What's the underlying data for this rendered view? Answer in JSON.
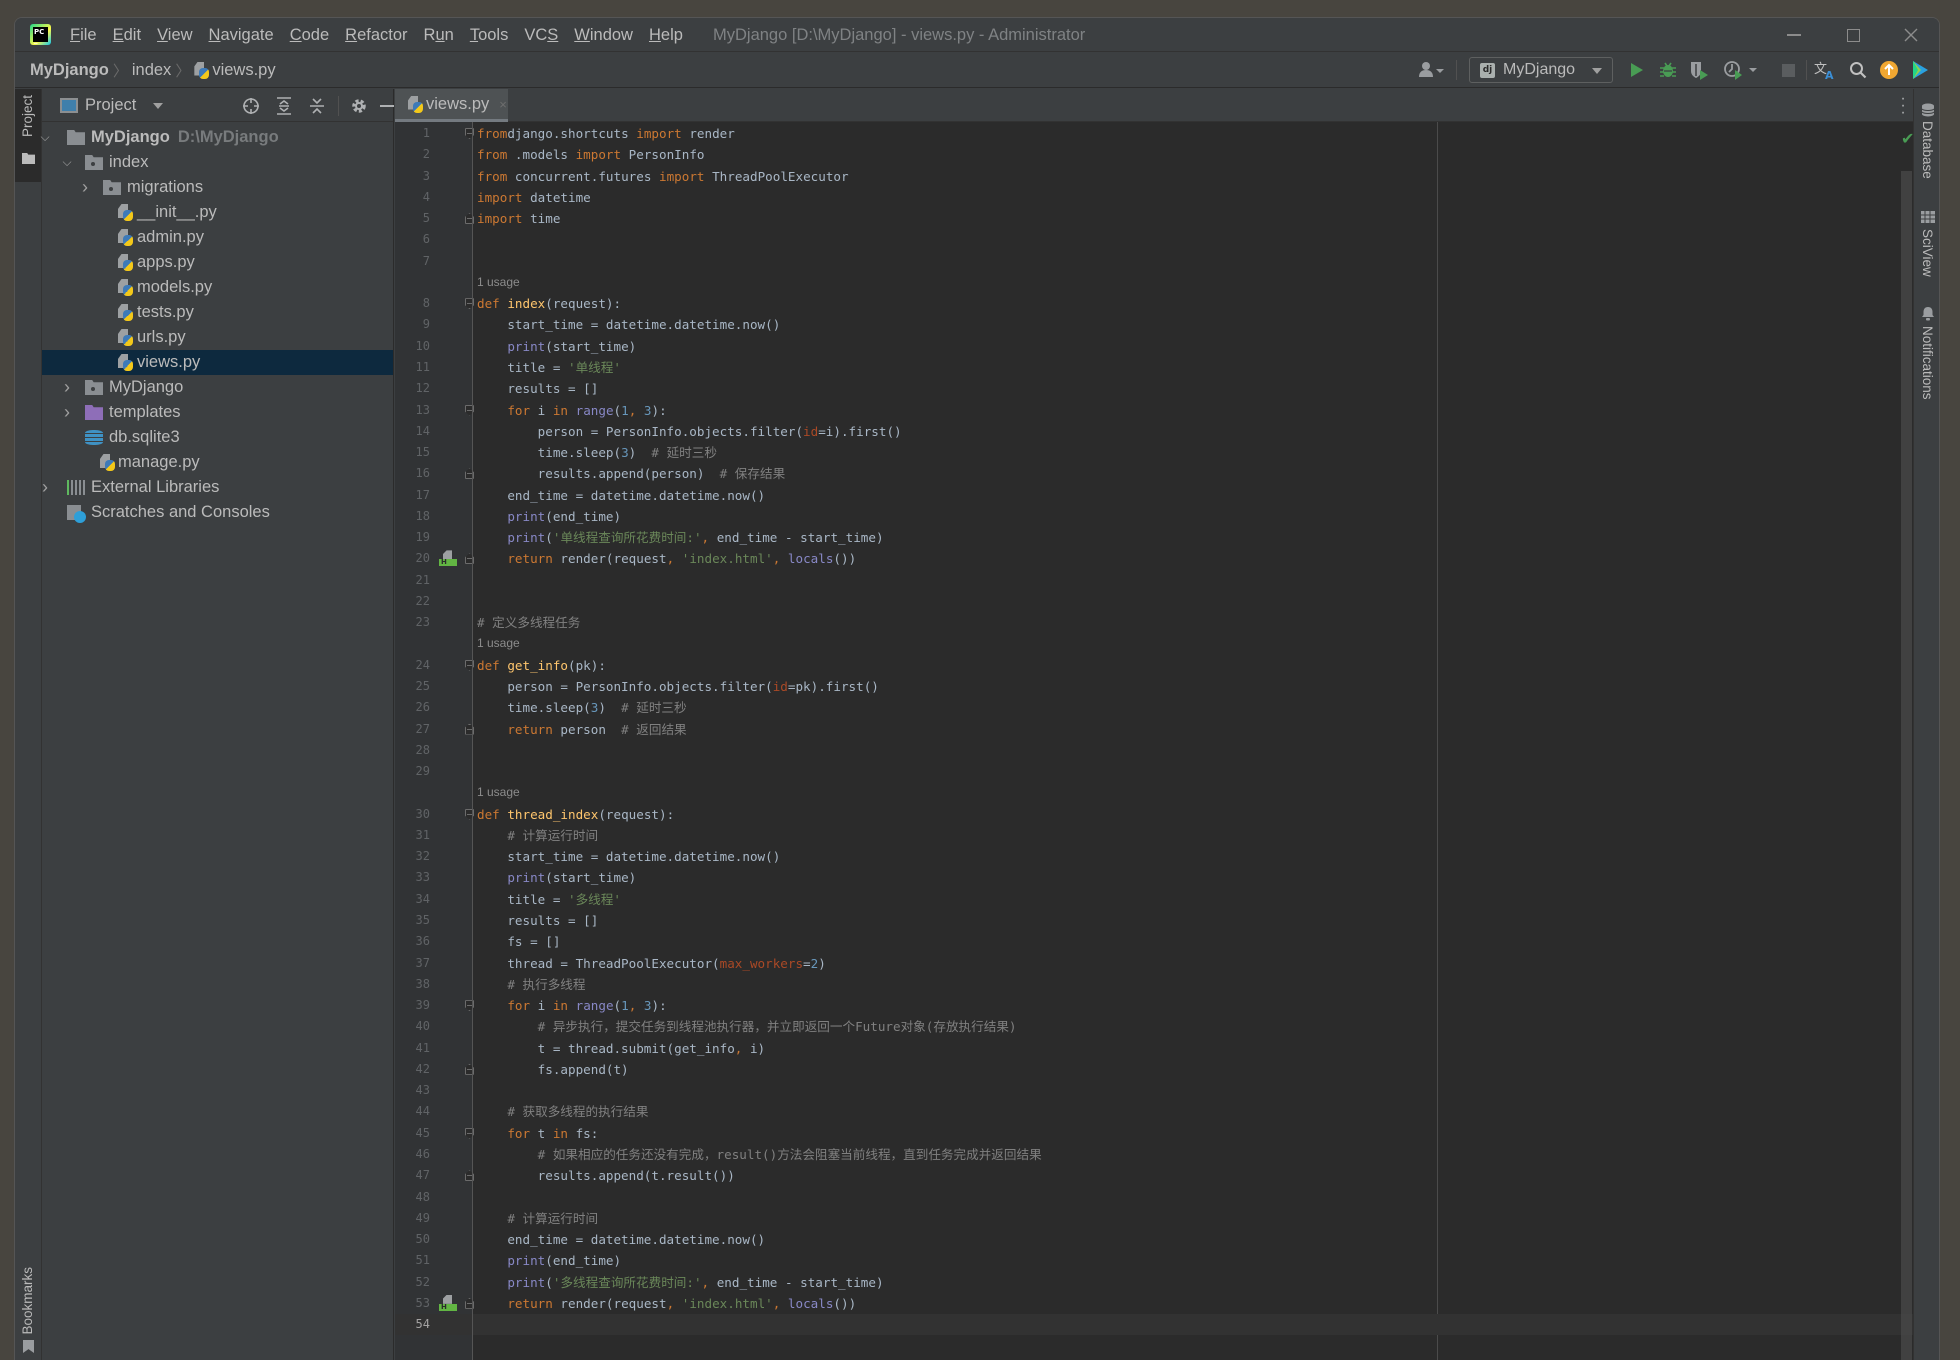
{
  "window": {
    "title": "MyDjango [D:\\MyDjango] - views.py - Administrator",
    "menu": [
      {
        "label": "File",
        "mnemonic": "F"
      },
      {
        "label": "Edit",
        "mnemonic": "E"
      },
      {
        "label": "View",
        "mnemonic": "V"
      },
      {
        "label": "Navigate",
        "mnemonic": "N"
      },
      {
        "label": "Code",
        "mnemonic": "C"
      },
      {
        "label": "Refactor",
        "mnemonic": "R"
      },
      {
        "label": "Run",
        "mnemonic": "u"
      },
      {
        "label": "Tools",
        "mnemonic": "T"
      },
      {
        "label": "VCS",
        "mnemonic": "S"
      },
      {
        "label": "Window",
        "mnemonic": "W"
      },
      {
        "label": "Help",
        "mnemonic": "H"
      }
    ],
    "controls": {
      "minimize": "minimize",
      "maximize": "maximize",
      "close": "close"
    }
  },
  "navbar": {
    "breadcrumb": [
      "MyDjango",
      "index",
      "views.py"
    ],
    "run_config": "MyDjango",
    "icons": [
      "user-icon",
      "run-icon",
      "debug-icon",
      "coverage-icon",
      "profile-icon",
      "stop-icon",
      "translate-icon",
      "search-icon",
      "update-icon",
      "plugin-icon"
    ]
  },
  "left_strip": {
    "project_tab": "Project",
    "bookmarks_tab": "Bookmarks"
  },
  "right_strip": {
    "tabs": [
      "Database",
      "SciView",
      "Notifications"
    ]
  },
  "project_panel": {
    "title": "Project",
    "tree": [
      {
        "label": "MyDjango",
        "hint": "D:\\MyDjango",
        "depth": 0,
        "type": "folder",
        "expanded": true,
        "bold": true
      },
      {
        "label": "index",
        "depth": 1,
        "type": "package",
        "expanded": true
      },
      {
        "label": "migrations",
        "depth": 2,
        "type": "package",
        "expanded": false
      },
      {
        "label": "__init__.py",
        "depth": 3,
        "type": "python"
      },
      {
        "label": "admin.py",
        "depth": 3,
        "type": "python"
      },
      {
        "label": "apps.py",
        "depth": 3,
        "type": "python"
      },
      {
        "label": "models.py",
        "depth": 3,
        "type": "python"
      },
      {
        "label": "tests.py",
        "depth": 3,
        "type": "python"
      },
      {
        "label": "urls.py",
        "depth": 3,
        "type": "python"
      },
      {
        "label": "views.py",
        "depth": 3,
        "type": "python",
        "selected": true
      },
      {
        "label": "MyDjango",
        "depth": 1,
        "type": "package",
        "expanded": false
      },
      {
        "label": "templates",
        "depth": 1,
        "type": "templates",
        "expanded": false
      },
      {
        "label": "db.sqlite3",
        "depth": 1,
        "type": "database"
      },
      {
        "label": "manage.py",
        "depth": 1,
        "type": "python-root"
      },
      {
        "label": "External Libraries",
        "depth": 0,
        "type": "libraries",
        "expanded": false
      },
      {
        "label": "Scratches and Consoles",
        "depth": 0,
        "type": "scratches"
      }
    ]
  },
  "editor": {
    "tab": {
      "label": "views.py",
      "close": "×"
    },
    "current_line": 54,
    "inspection": "no-problems",
    "lines": [
      {
        "n": 1,
        "fold": "open",
        "tokens": [
          [
            "kw",
            "from"
          ],
          [
            "",
            "django.shortcuts "
          ],
          [
            "kw",
            "import"
          ],
          [
            "",
            " render"
          ]
        ]
      },
      {
        "n": 2,
        "tokens": [
          [
            "kw",
            "from"
          ],
          [
            "",
            " .models "
          ],
          [
            "kw",
            "import"
          ],
          [
            "",
            " PersonInfo"
          ]
        ]
      },
      {
        "n": 3,
        "tokens": [
          [
            "kw",
            "from"
          ],
          [
            "",
            " concurrent.futures "
          ],
          [
            "kw",
            "import"
          ],
          [
            "",
            " ThreadPoolExecutor"
          ]
        ]
      },
      {
        "n": 4,
        "tokens": [
          [
            "kw",
            "import"
          ],
          [
            "",
            " datetime"
          ]
        ]
      },
      {
        "n": 5,
        "fold": "close",
        "tokens": [
          [
            "kw",
            "import"
          ],
          [
            "",
            " time"
          ]
        ]
      },
      {
        "n": 6,
        "tokens": []
      },
      {
        "n": 7,
        "tokens": []
      },
      {
        "usage": "1 usage"
      },
      {
        "n": 8,
        "fold": "open",
        "tokens": [
          [
            "kw",
            "def "
          ],
          [
            "fn",
            "index"
          ],
          [
            "",
            "(request):"
          ]
        ]
      },
      {
        "n": 9,
        "tokens": [
          [
            "",
            "    start_time = datetime.datetime.now()"
          ]
        ]
      },
      {
        "n": 10,
        "tokens": [
          [
            "",
            "    "
          ],
          [
            "bi",
            "print"
          ],
          [
            "",
            "(start_time)"
          ]
        ]
      },
      {
        "n": 11,
        "tokens": [
          [
            "",
            "    title = "
          ],
          [
            "str",
            "'单线程'"
          ]
        ]
      },
      {
        "n": 12,
        "tokens": [
          [
            "",
            "    results = []"
          ]
        ]
      },
      {
        "n": 13,
        "fold": "open",
        "tokens": [
          [
            "",
            "    "
          ],
          [
            "kw",
            "for"
          ],
          [
            "",
            " i "
          ],
          [
            "kw",
            "in"
          ],
          [
            "",
            " "
          ],
          [
            "bi",
            "range"
          ],
          [
            "",
            "("
          ],
          [
            "num",
            "1"
          ],
          [
            "kw",
            ", "
          ],
          [
            "num",
            "3"
          ],
          [
            "",
            "):"
          ]
        ]
      },
      {
        "n": 14,
        "tokens": [
          [
            "",
            "        person = PersonInfo.objects.filter("
          ],
          [
            "pa",
            "id"
          ],
          [
            "",
            "=i).first()"
          ]
        ]
      },
      {
        "n": 15,
        "tokens": [
          [
            "",
            "        time.sleep("
          ],
          [
            "num",
            "3"
          ],
          [
            "",
            ")  "
          ],
          [
            "cm",
            "# 延时三秒"
          ]
        ]
      },
      {
        "n": 16,
        "fold": "close",
        "tokens": [
          [
            "",
            "        results.append(person)  "
          ],
          [
            "cm",
            "# 保存结果"
          ]
        ]
      },
      {
        "n": 17,
        "tokens": [
          [
            "",
            "    end_time = datetime.datetime.now()"
          ]
        ]
      },
      {
        "n": 18,
        "tokens": [
          [
            "",
            "    "
          ],
          [
            "bi",
            "print"
          ],
          [
            "",
            "(end_time)"
          ]
        ]
      },
      {
        "n": 19,
        "tokens": [
          [
            "",
            "    "
          ],
          [
            "bi",
            "print"
          ],
          [
            "",
            "("
          ],
          [
            "str",
            "'单线程查询所花费时间:'"
          ],
          [
            "kw",
            ", "
          ],
          [
            "",
            "end_time - start_time)"
          ]
        ]
      },
      {
        "n": 20,
        "fold": "close",
        "marker": "html",
        "tokens": [
          [
            "",
            "    "
          ],
          [
            "kw",
            "return"
          ],
          [
            "",
            " render(request"
          ],
          [
            "kw",
            ", "
          ],
          [
            "str",
            "'index.html'"
          ],
          [
            "kw",
            ", "
          ],
          [
            "bi",
            "locals"
          ],
          [
            "",
            "())"
          ]
        ]
      },
      {
        "n": 21,
        "tokens": []
      },
      {
        "n": 22,
        "tokens": []
      },
      {
        "n": 23,
        "tokens": [
          [
            "cm",
            "# 定义多线程任务"
          ]
        ]
      },
      {
        "usage": "1 usage"
      },
      {
        "n": 24,
        "fold": "open",
        "tokens": [
          [
            "kw",
            "def "
          ],
          [
            "fn",
            "get_info"
          ],
          [
            "",
            "(pk):"
          ]
        ]
      },
      {
        "n": 25,
        "tokens": [
          [
            "",
            "    person = PersonInfo.objects.filter("
          ],
          [
            "pa",
            "id"
          ],
          [
            "",
            "=pk).first()"
          ]
        ]
      },
      {
        "n": 26,
        "tokens": [
          [
            "",
            "    time.sleep("
          ],
          [
            "num",
            "3"
          ],
          [
            "",
            ")  "
          ],
          [
            "cm",
            "# 延时三秒"
          ]
        ]
      },
      {
        "n": 27,
        "fold": "close",
        "tokens": [
          [
            "",
            "    "
          ],
          [
            "kw",
            "return"
          ],
          [
            "",
            " person  "
          ],
          [
            "cm",
            "# 返回结果"
          ]
        ]
      },
      {
        "n": 28,
        "tokens": []
      },
      {
        "n": 29,
        "tokens": []
      },
      {
        "usage": "1 usage"
      },
      {
        "n": 30,
        "fold": "open",
        "tokens": [
          [
            "kw",
            "def "
          ],
          [
            "fn",
            "thread_index"
          ],
          [
            "",
            "(request):"
          ]
        ]
      },
      {
        "n": 31,
        "tokens": [
          [
            "",
            "    "
          ],
          [
            "cm",
            "# 计算运行时间"
          ]
        ]
      },
      {
        "n": 32,
        "tokens": [
          [
            "",
            "    start_time = datetime.datetime.now()"
          ]
        ]
      },
      {
        "n": 33,
        "tokens": [
          [
            "",
            "    "
          ],
          [
            "bi",
            "print"
          ],
          [
            "",
            "(start_time)"
          ]
        ]
      },
      {
        "n": 34,
        "tokens": [
          [
            "",
            "    title = "
          ],
          [
            "str",
            "'多线程'"
          ]
        ]
      },
      {
        "n": 35,
        "tokens": [
          [
            "",
            "    results = []"
          ]
        ]
      },
      {
        "n": 36,
        "tokens": [
          [
            "",
            "    fs = []"
          ]
        ]
      },
      {
        "n": 37,
        "tokens": [
          [
            "",
            "    thread = ThreadPoolExecutor("
          ],
          [
            "pa",
            "max_workers"
          ],
          [
            "",
            "="
          ],
          [
            "num",
            "2"
          ],
          [
            "",
            ")"
          ]
        ]
      },
      {
        "n": 38,
        "tokens": [
          [
            "",
            "    "
          ],
          [
            "cm",
            "# 执行多线程"
          ]
        ]
      },
      {
        "n": 39,
        "fold": "open",
        "tokens": [
          [
            "",
            "    "
          ],
          [
            "kw",
            "for"
          ],
          [
            "",
            " i "
          ],
          [
            "kw",
            "in"
          ],
          [
            "",
            " "
          ],
          [
            "bi",
            "range"
          ],
          [
            "",
            "("
          ],
          [
            "num",
            "1"
          ],
          [
            "kw",
            ", "
          ],
          [
            "num",
            "3"
          ],
          [
            "",
            "):"
          ]
        ]
      },
      {
        "n": 40,
        "tokens": [
          [
            "",
            "        "
          ],
          [
            "cm",
            "# 异步执行，提交任务到线程池执行器，并立即返回一个Future对象(存放执行结果)"
          ]
        ]
      },
      {
        "n": 41,
        "tokens": [
          [
            "",
            "        t = thread.submit(get_info"
          ],
          [
            "kw",
            ", "
          ],
          [
            "",
            "i)"
          ]
        ]
      },
      {
        "n": 42,
        "fold": "close",
        "tokens": [
          [
            "",
            "        fs.append(t)"
          ]
        ]
      },
      {
        "n": 43,
        "tokens": []
      },
      {
        "n": 44,
        "tokens": [
          [
            "",
            "    "
          ],
          [
            "cm",
            "# 获取多线程的执行结果"
          ]
        ]
      },
      {
        "n": 45,
        "fold": "open",
        "tokens": [
          [
            "",
            "    "
          ],
          [
            "kw",
            "for"
          ],
          [
            "",
            " t "
          ],
          [
            "kw",
            "in"
          ],
          [
            "",
            " fs:"
          ]
        ]
      },
      {
        "n": 46,
        "tokens": [
          [
            "",
            "        "
          ],
          [
            "cm",
            "# 如果相应的任务还没有完成，result()方法会阻塞当前线程，直到任务完成并返回结果"
          ]
        ]
      },
      {
        "n": 47,
        "fold": "close",
        "tokens": [
          [
            "",
            "        results.append(t.result())"
          ]
        ]
      },
      {
        "n": 48,
        "tokens": []
      },
      {
        "n": 49,
        "tokens": [
          [
            "",
            "    "
          ],
          [
            "cm",
            "# 计算运行时间"
          ]
        ]
      },
      {
        "n": 50,
        "tokens": [
          [
            "",
            "    end_time = datetime.datetime.now()"
          ]
        ]
      },
      {
        "n": 51,
        "tokens": [
          [
            "",
            "    "
          ],
          [
            "bi",
            "print"
          ],
          [
            "",
            "(end_time)"
          ]
        ]
      },
      {
        "n": 52,
        "tokens": [
          [
            "",
            "    "
          ],
          [
            "bi",
            "print"
          ],
          [
            "",
            "("
          ],
          [
            "str",
            "'多线程查询所花费时间:'"
          ],
          [
            "kw",
            ", "
          ],
          [
            "",
            "end_time - start_time)"
          ]
        ]
      },
      {
        "n": 53,
        "fold": "close",
        "marker": "html",
        "tokens": [
          [
            "",
            "    "
          ],
          [
            "kw",
            "return"
          ],
          [
            "",
            " render(request"
          ],
          [
            "kw",
            ", "
          ],
          [
            "str",
            "'index.html'"
          ],
          [
            "kw",
            ", "
          ],
          [
            "bi",
            "locals"
          ],
          [
            "",
            "())"
          ]
        ]
      },
      {
        "n": 54,
        "tokens": []
      }
    ]
  },
  "colors": {
    "keyword": "#cc7832",
    "function": "#ffc66d",
    "builtin": "#8888c6",
    "number": "#6897bb",
    "string": "#6a8759",
    "comment": "#808080",
    "param": "#aa4926",
    "text": "#a9b7c6",
    "selection": "#0d293e",
    "run_green": "#499c54",
    "update_orange": "#f0a732"
  }
}
